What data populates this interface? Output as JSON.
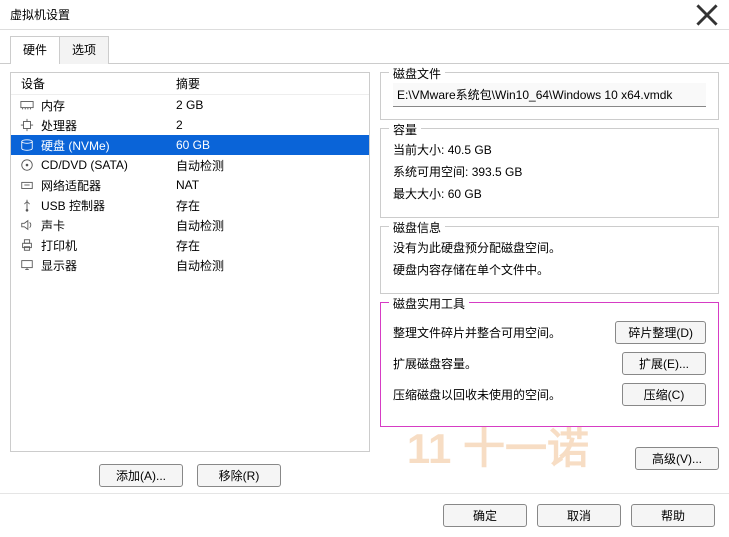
{
  "window": {
    "title": "虚拟机设置"
  },
  "tabs": {
    "hardware": "硬件",
    "options": "选项"
  },
  "headers": {
    "device": "设备",
    "summary": "摘要"
  },
  "devices": [
    {
      "name": "内存",
      "summary": "2 GB",
      "icon": "memory"
    },
    {
      "name": "处理器",
      "summary": "2",
      "icon": "cpu"
    },
    {
      "name": "硬盘 (NVMe)",
      "summary": "60 GB",
      "icon": "disk",
      "selected": true
    },
    {
      "name": "CD/DVD (SATA)",
      "summary": "自动检测",
      "icon": "cd"
    },
    {
      "name": "网络适配器",
      "summary": "NAT",
      "icon": "net"
    },
    {
      "name": "USB 控制器",
      "summary": "存在",
      "icon": "usb"
    },
    {
      "name": "声卡",
      "summary": "自动检测",
      "icon": "sound"
    },
    {
      "name": "打印机",
      "summary": "存在",
      "icon": "printer"
    },
    {
      "name": "显示器",
      "summary": "自动检测",
      "icon": "display"
    }
  ],
  "left_buttons": {
    "add": "添加(A)...",
    "remove": "移除(R)"
  },
  "disk_file": {
    "group": "磁盘文件",
    "path": "E:\\VMware系统包\\Win10_64\\Windows 10 x64.vmdk"
  },
  "capacity": {
    "group": "容量",
    "current_label": "当前大小:",
    "current_val": "40.5 GB",
    "free_label": "系统可用空间:",
    "free_val": "393.5 GB",
    "max_label": "最大大小:",
    "max_val": "60 GB"
  },
  "disk_info": {
    "group": "磁盘信息",
    "line1": "没有为此硬盘预分配磁盘空间。",
    "line2": "硬盘内容存储在单个文件中。"
  },
  "tools": {
    "group": "磁盘实用工具",
    "defrag_desc": "整理文件碎片并整合可用空间。",
    "defrag_btn": "碎片整理(D)",
    "expand_desc": "扩展磁盘容量。",
    "expand_btn": "扩展(E)...",
    "compact_desc": "压缩磁盘以回收未使用的空间。",
    "compact_btn": "压缩(C)"
  },
  "advanced_btn": "高级(V)...",
  "dialog": {
    "ok": "确定",
    "cancel": "取消",
    "help": "帮助"
  },
  "watermark": "11 十一诺"
}
